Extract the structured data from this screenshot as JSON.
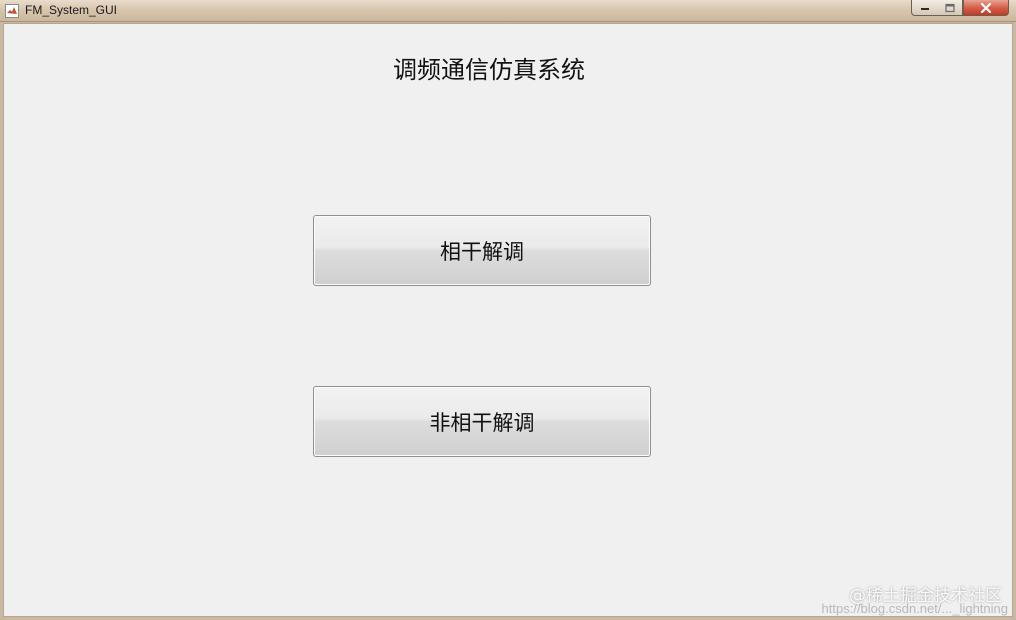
{
  "window": {
    "title": "FM_System_GUI",
    "icon": "matlab-icon",
    "controls": {
      "minimize_icon": "minimize-icon",
      "maximize_icon": "maximize-icon",
      "close_icon": "close-icon"
    }
  },
  "main": {
    "title": "调频通信仿真系统",
    "buttons": [
      {
        "label": "相干解调"
      },
      {
        "label": "非相干解调"
      }
    ]
  },
  "watermark": {
    "text": "@稀土掘金技术社区",
    "url": "https://blog.csdn.net/..._lightning"
  },
  "colors": {
    "client_background": "#f0f0f0",
    "close_button": "#c13b24",
    "text": "#111111"
  }
}
